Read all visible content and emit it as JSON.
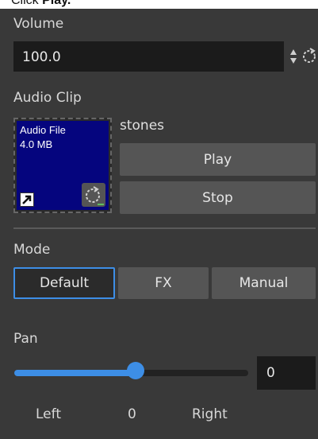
{
  "caption": {
    "prefix": "Click ",
    "bold": "Play."
  },
  "volume": {
    "label": "Volume",
    "value": "100.0"
  },
  "audio_clip": {
    "label": "Audio Clip",
    "thumb_title": "Audio File",
    "thumb_size": "4.0 MB",
    "clip_name": "stones",
    "play_label": "Play",
    "stop_label": "Stop"
  },
  "mode": {
    "label": "Mode",
    "options": [
      "Default",
      "FX",
      "Manual"
    ],
    "selected": "Default"
  },
  "pan": {
    "label": "Pan",
    "value": "0",
    "fraction": 0.52,
    "left_label": "Left",
    "center_label": "0",
    "right_label": "Right"
  },
  "colors": {
    "accent": "#3d8ee6",
    "clip_bg": "#05057e",
    "panel": "#393939"
  }
}
